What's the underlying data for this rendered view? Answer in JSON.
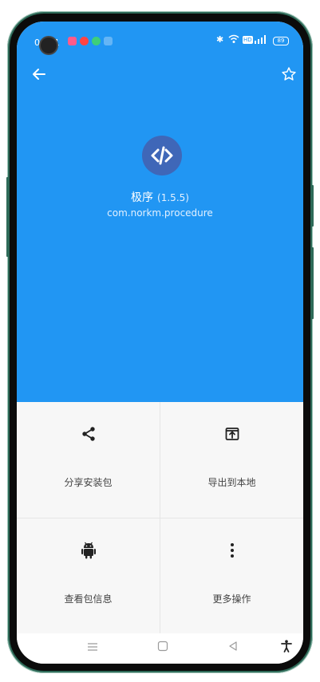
{
  "status_bar": {
    "time": "00:41",
    "battery": "89"
  },
  "app": {
    "name": "极序",
    "version": "(1.5.5)",
    "package": "com.norkm.procedure"
  },
  "actions": [
    {
      "label": "分享安装包",
      "icon": "share-icon"
    },
    {
      "label": "导出到本地",
      "icon": "export-icon"
    },
    {
      "label": "查看包信息",
      "icon": "android-icon"
    },
    {
      "label": "更多操作",
      "icon": "more-vert-icon"
    }
  ],
  "nav_bar": [
    "menu-icon",
    "home-icon",
    "back-triangle-icon",
    "accessibility-icon"
  ],
  "colors": {
    "header": "#2196f3",
    "app_icon_bg": "#3f67b8",
    "action_bg": "#f7f7f7"
  }
}
